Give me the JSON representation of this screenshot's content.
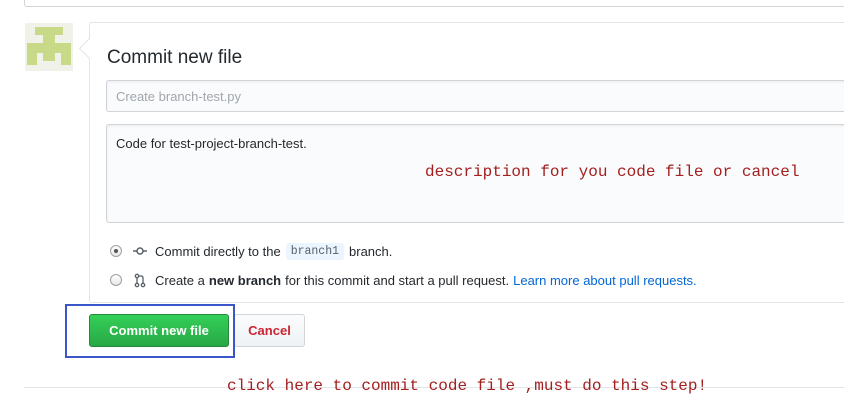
{
  "form": {
    "title": "Commit new file",
    "summary_placeholder": "Create branch-test.py",
    "description_value": "Code for test-project-branch-test."
  },
  "options": {
    "direct": {
      "text_before": "Commit directly to the",
      "branch_name": "branch1",
      "text_after": "branch.",
      "selected": true
    },
    "new_branch": {
      "text_before": "Create a",
      "bold_text": "new branch",
      "text_after": "for this commit and start a pull request.",
      "link_text": "Learn more about pull requests.",
      "selected": false
    }
  },
  "buttons": {
    "commit_label": "Commit new file",
    "cancel_label": "Cancel"
  },
  "annotations": {
    "description_note": "description for you code file or cancel",
    "commit_note": "click here to commit code file ,must do this step!"
  },
  "colors": {
    "commit_button": "#28a745",
    "cancel_text": "#cb2431",
    "link": "#0366d6",
    "annotation_text": "#a32020",
    "highlight_box": "#3a56c9",
    "avatar": "#c8d987"
  },
  "icons": {
    "avatar": "identicon-avatar",
    "direct_commit": "git-commit-icon",
    "new_branch": "git-pull-request-icon"
  }
}
